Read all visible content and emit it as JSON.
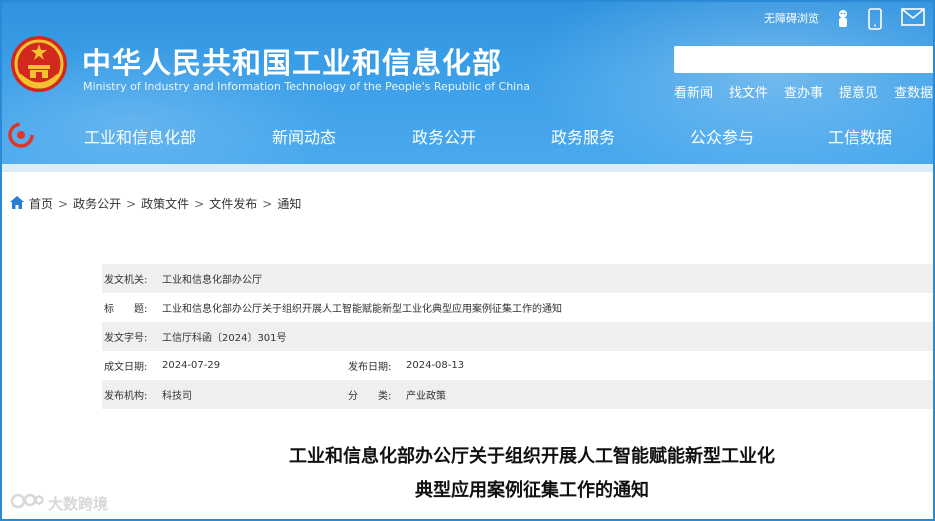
{
  "topbar": {
    "accessibility_label": "无障碍浏览"
  },
  "site": {
    "title": "中华人民共和国工业和信息化部",
    "subtitle": "Ministry of Industry and Information Technology of the People's Republic of China"
  },
  "search": {
    "placeholder": ""
  },
  "quick_links": [
    "看新闻",
    "找文件",
    "查办事",
    "提意见",
    "查数据"
  ],
  "nav": [
    "工业和信息化部",
    "新闻动态",
    "政务公开",
    "政务服务",
    "公众参与",
    "工信数据"
  ],
  "breadcrumb": [
    "首页",
    "政务公开",
    "政策文件",
    "文件发布",
    "通知"
  ],
  "meta": {
    "issuer_label": "发文机关:",
    "issuer": "工业和信息化部办公厅",
    "title_label": "标　　题:",
    "title": "工业和信息化部办公厅关于组织开展人工智能赋能新型工业化典型应用案例征集工作的通知",
    "docno_label": "发文字号:",
    "docno": "工信厅科函〔2024〕301号",
    "created_label": "成文日期:",
    "created": "2024-07-29",
    "published_label": "发布日期:",
    "published": "2024-08-13",
    "org_label": "发布机构:",
    "org": "科技司",
    "category_label": "分　　类:",
    "category": "产业政策"
  },
  "document": {
    "title_line1": "工业和信息化部办公厅关于组织开展人工智能赋能新型工业化",
    "title_line2": "典型应用案例征集工作的通知"
  },
  "watermark": {
    "text": "大数跨境"
  },
  "colors": {
    "header_blue": "#3b9fe8",
    "frame_blue": "#2a8ad6",
    "meta_shade": "#efefef"
  }
}
